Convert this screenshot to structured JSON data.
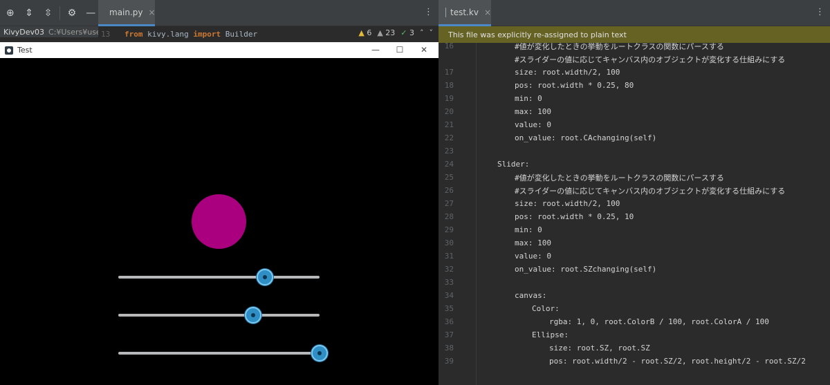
{
  "ide": {
    "project_name": "KivyDev03",
    "project_path": "C:¥Users¥user¥",
    "main_tab": "main.py",
    "kv_tab": "test.kv",
    "close_glyph": "×",
    "line_number": "13",
    "code_from": "from",
    "code_module": " kivy.lang ",
    "code_import": "import",
    "code_name": " Builder",
    "warnings": "6",
    "weak_warnings": "23",
    "ok_count": "3"
  },
  "kivy_window": {
    "title": "Test",
    "ellipse_color": "#aa007f",
    "sliders": [
      {
        "value": 0.73
      },
      {
        "value": 0.67
      },
      {
        "value": 1.0
      }
    ]
  },
  "editor": {
    "notification": "This file was explicitly re-assigned to plain text",
    "lines": [
      {
        "n": "16",
        "indent": 2,
        "text": "#値が変化したときの挙動をルートクラスの関数にパースする"
      },
      {
        "n": "",
        "indent": 2,
        "text": "#スライダーの値に応じてキャンバス内のオブジェクトが変化する仕組みにする"
      },
      {
        "n": "17",
        "indent": 2,
        "text": "size: root.width/2, 100"
      },
      {
        "n": "18",
        "indent": 2,
        "text": "pos: root.width * 0.25, 80"
      },
      {
        "n": "19",
        "indent": 2,
        "text": "min: 0"
      },
      {
        "n": "20",
        "indent": 2,
        "text": "max: 100"
      },
      {
        "n": "21",
        "indent": 2,
        "text": "value: 0"
      },
      {
        "n": "22",
        "indent": 2,
        "text": "on_value: root.CAchanging(self)"
      },
      {
        "n": "23",
        "indent": 0,
        "text": ""
      },
      {
        "n": "24",
        "indent": 1,
        "text": "Slider:"
      },
      {
        "n": "25",
        "indent": 2,
        "text": "#値が変化したときの挙動をルートクラスの関数にパースする"
      },
      {
        "n": "26",
        "indent": 2,
        "text": "#スライダーの値に応じてキャンバス内のオブジェクトが変化する仕組みにする"
      },
      {
        "n": "27",
        "indent": 2,
        "text": "size: root.width/2, 100"
      },
      {
        "n": "28",
        "indent": 2,
        "text": "pos: root.width * 0.25, 10"
      },
      {
        "n": "29",
        "indent": 2,
        "text": "min: 0"
      },
      {
        "n": "30",
        "indent": 2,
        "text": "max: 100"
      },
      {
        "n": "31",
        "indent": 2,
        "text": "value: 0"
      },
      {
        "n": "32",
        "indent": 2,
        "text": "on_value: root.SZchanging(self)"
      },
      {
        "n": "33",
        "indent": 0,
        "text": ""
      },
      {
        "n": "34",
        "indent": 2,
        "text": "canvas:"
      },
      {
        "n": "35",
        "indent": 3,
        "text": "Color:"
      },
      {
        "n": "36",
        "indent": 4,
        "text": "rgba: 1, 0, root.ColorB / 100, root.ColorA / 100"
      },
      {
        "n": "37",
        "indent": 3,
        "text": "Ellipse:"
      },
      {
        "n": "38",
        "indent": 4,
        "text": "size: root.SZ, root.SZ"
      },
      {
        "n": "39",
        "indent": 4,
        "text": "pos: root.width/2 - root.SZ/2, root.height/2 - root.SZ/2"
      }
    ]
  }
}
